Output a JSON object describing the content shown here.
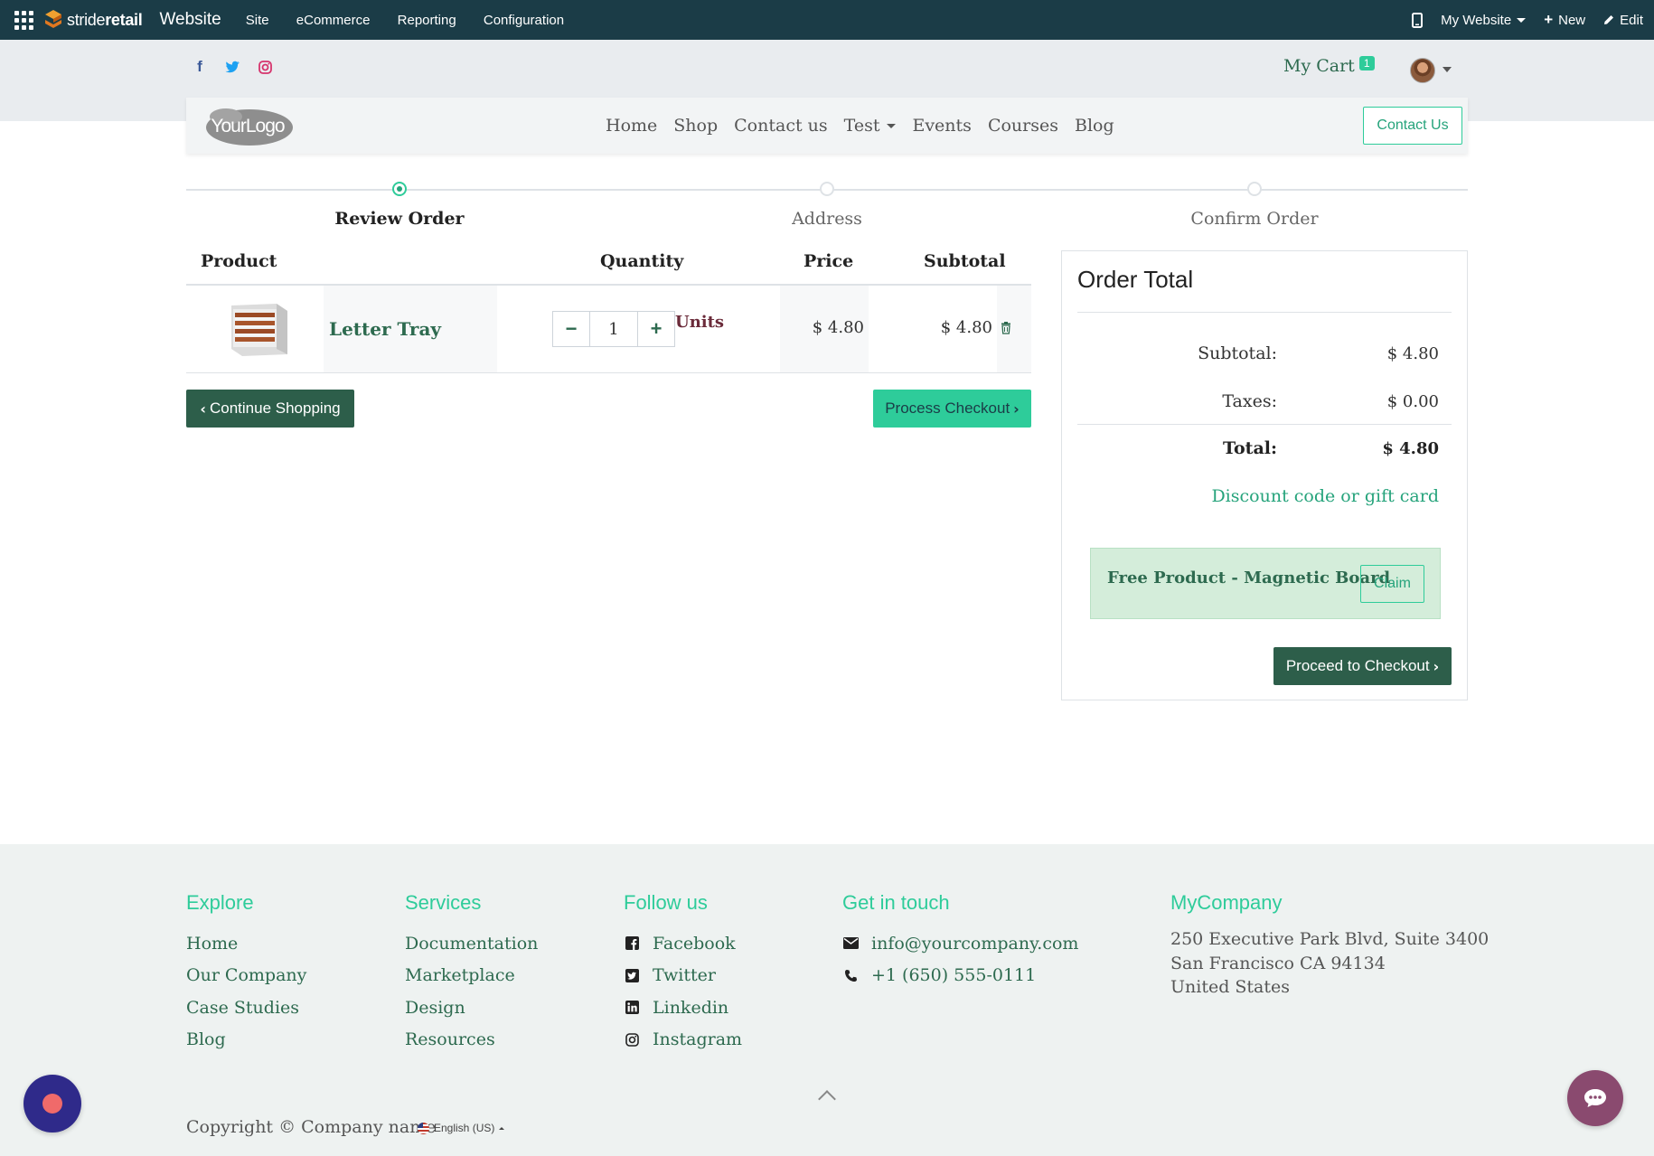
{
  "topbar": {
    "brand_light": "stride",
    "brand_bold": "retail",
    "app_title": "Website",
    "menu": [
      "Site",
      "eCommerce",
      "Reporting",
      "Configuration"
    ],
    "website_selector": "My Website",
    "new_label": "New",
    "edit_label": "Edit"
  },
  "header": {
    "social_icons": [
      "facebook-icon",
      "twitter-icon",
      "instagram-icon"
    ],
    "cart_label": "My Cart",
    "cart_count": "1",
    "logo_text": "YourLogo",
    "nav": [
      "Home",
      "Shop",
      "Contact us",
      "Test",
      "Events",
      "Courses",
      "Blog"
    ],
    "contact_button": "Contact Us"
  },
  "progress": {
    "steps": [
      "Review Order",
      "Address",
      "Confirm Order"
    ],
    "active_index": 0
  },
  "cart": {
    "headers": {
      "product": "Product",
      "quantity": "Quantity",
      "price": "Price",
      "subtotal": "Subtotal"
    },
    "lines": [
      {
        "name": "Letter Tray",
        "quantity": "1",
        "unit": "Units",
        "price": "$ 4.80",
        "subtotal": "$ 4.80"
      }
    ],
    "continue_button": "Continue Shopping",
    "process_button": "Process Checkout"
  },
  "order_total": {
    "title": "Order Total",
    "subtotal_label": "Subtotal:",
    "subtotal_value": "$ 4.80",
    "taxes_label": "Taxes:",
    "taxes_value": "$ 0.00",
    "total_label": "Total:",
    "total_value": "$ 4.80",
    "discount_link": "Discount code or gift card",
    "promo_text": "Free Product - Magnetic Board",
    "claim_button": "Claim",
    "proceed_button": "Proceed to Checkout"
  },
  "footer": {
    "explore": {
      "title": "Explore",
      "links": [
        "Home",
        "Our Company",
        "Case Studies",
        "Blog"
      ]
    },
    "services": {
      "title": "Services",
      "links": [
        "Documentation",
        "Marketplace",
        "Design",
        "Resources"
      ]
    },
    "follow": {
      "title": "Follow us",
      "links": [
        "Facebook",
        "Twitter",
        "Linkedin",
        "Instagram"
      ]
    },
    "contact": {
      "title": "Get in touch",
      "email": "info@yourcompany.com",
      "phone": "+1 (650) 555-0111"
    },
    "company": {
      "title": "MyCompany",
      "address": [
        "250 Executive Park Blvd, Suite 3400",
        "San Francisco CA 94134",
        "United States"
      ]
    },
    "copyright": "Copyright © Company name",
    "language": "English (US)"
  },
  "colors": {
    "topbar": "#1b3c47",
    "accent": "#2ecc9a",
    "dark_green": "#2d5e4a",
    "link_green": "#2d6a4f",
    "promo_bg": "#d4edda"
  }
}
